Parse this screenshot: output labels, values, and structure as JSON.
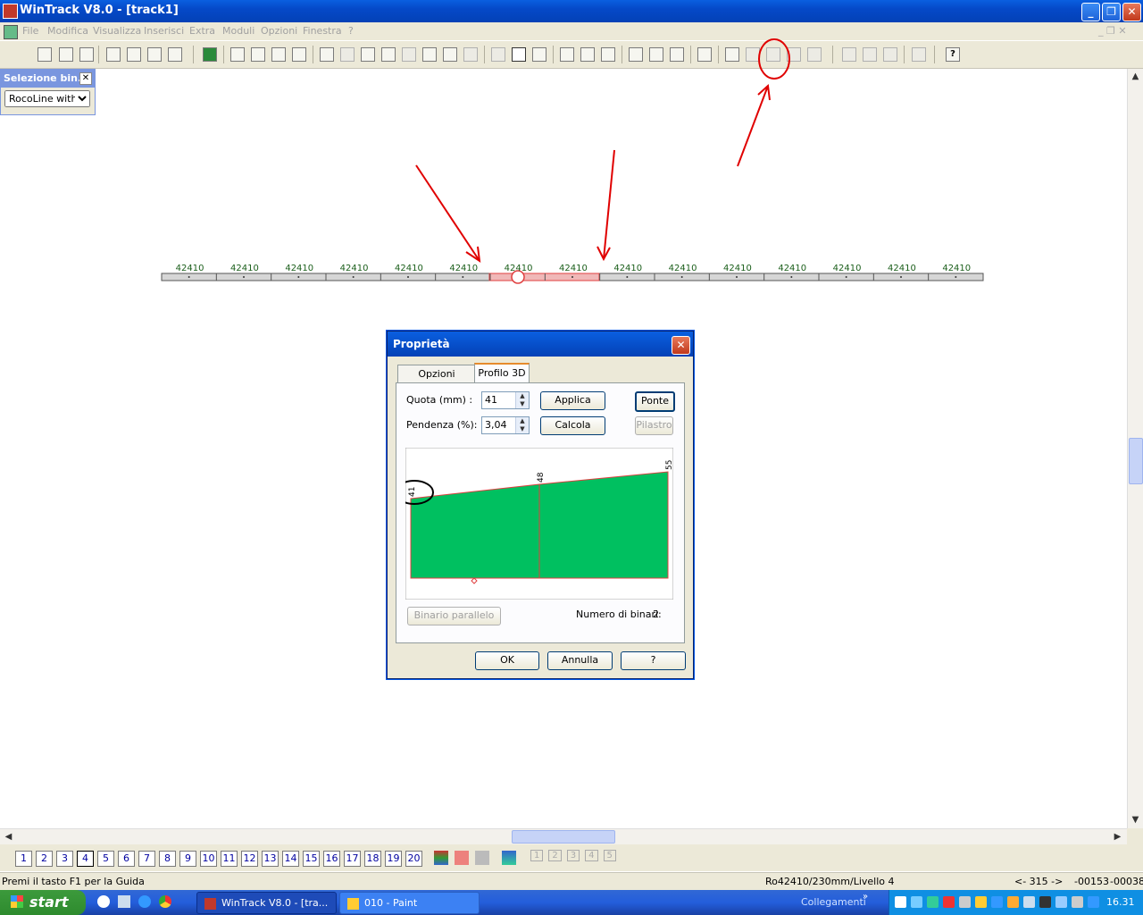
{
  "window": {
    "title": "WinTrack  V8.0 - [track1]"
  },
  "menu": [
    "File",
    "Modifica",
    "Visualizza",
    "Inserisci",
    "Extra",
    "Moduli",
    "Opzioni",
    "Finestra",
    "?"
  ],
  "selection_panel": {
    "title": "Selezione bin...",
    "selected": "RocoLine witho"
  },
  "track": {
    "label": "42410",
    "count": 15
  },
  "dialog": {
    "title": "Proprietà",
    "tabs": [
      "Opzioni generali",
      "Profilo 3D"
    ],
    "quota_label": "Quota (mm) :",
    "quota_value": "41",
    "pendenza_label": "Pendenza (%):",
    "pendenza_value": "3,04",
    "applica": "Applica",
    "calcola": "Calcola",
    "ponte": "Ponte",
    "pilastro": "Pilastro",
    "profile_values": [
      "41",
      "48",
      "55"
    ],
    "binario_parallelo": "Binario parallelo",
    "numero_label": "Numero di binari:",
    "numero_value": "2",
    "ok": "OK",
    "annulla": "Annulla",
    "help": "?"
  },
  "pages": [
    "1",
    "2",
    "3",
    "4",
    "5",
    "6",
    "7",
    "8",
    "9",
    "10",
    "11",
    "12",
    "13",
    "14",
    "15",
    "16",
    "17",
    "18",
    "19",
    "20"
  ],
  "status": {
    "help": "Premi il tasto F1 per la Guida",
    "info": "Ro42410/230mm/Livello 4",
    "arrows": "<- 315 ->",
    "x": "-00153",
    "y": "-00038"
  },
  "taskbar": {
    "start": "start",
    "task1": "WinTrack  V8.0 - [tra...",
    "task2": "010 - Paint",
    "links": "Collegamenti",
    "clock": "16.31"
  },
  "colors": {
    "accent": "#0a5fe0",
    "profile_fill": "#00c060",
    "annotation": "#e00000"
  }
}
